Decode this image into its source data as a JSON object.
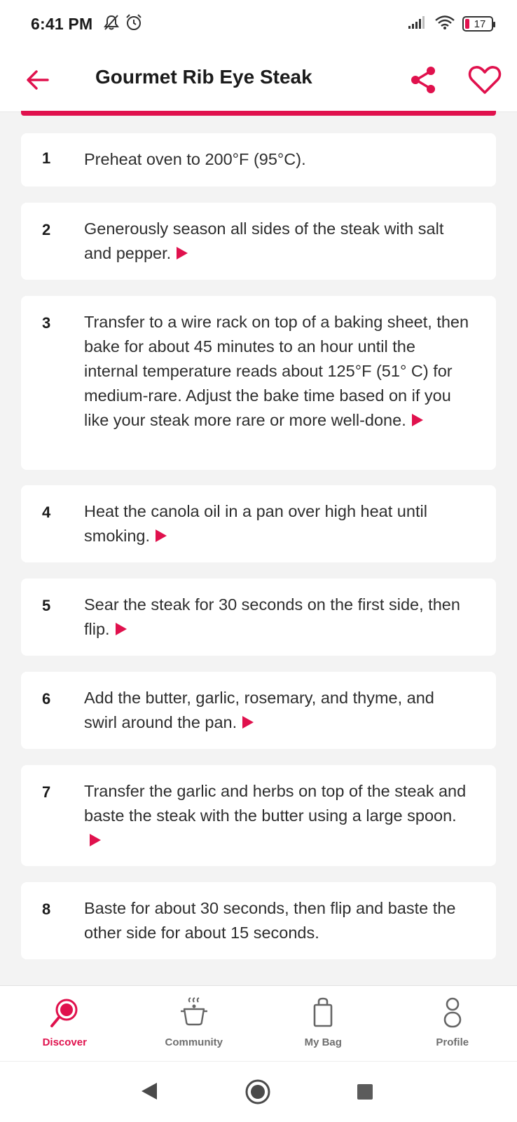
{
  "status_bar": {
    "time": "6:41 PM",
    "battery": "17",
    "icons": [
      "bell-off-icon",
      "alarm-icon",
      "signal-icon",
      "wifi-icon",
      "battery-icon"
    ]
  },
  "header": {
    "title": "Gourmet Rib Eye Steak",
    "icons": [
      "back-arrow-icon",
      "share-icon",
      "heart-icon"
    ]
  },
  "colors": {
    "accent": "#e0114d",
    "background": "#f3f3f3",
    "card": "#ffffff"
  },
  "steps": [
    {
      "number": "1",
      "text": "Preheat oven to 200°F (95°C).",
      "has_video": false
    },
    {
      "number": "2",
      "text": "Generously season all sides of the steak with salt and pepper.",
      "has_video": true
    },
    {
      "number": "3",
      "text": "Transfer to a wire rack on top of a baking sheet, then bake for about 45 minutes to an hour until the internal temperature reads about 125°F (51° C) for medium-rare. Adjust the bake time based on if you like your steak more rare or more well-done.",
      "has_video": true
    },
    {
      "number": "4",
      "text": "Heat the canola oil in a pan over high heat until smoking.",
      "has_video": true
    },
    {
      "number": "5",
      "text": "Sear the steak for 30 seconds on the first side, then flip.",
      "has_video": true
    },
    {
      "number": "6",
      "text": "Add the butter, garlic, rosemary, and thyme, and swirl around the pan.",
      "has_video": true
    },
    {
      "number": "7",
      "text": "Transfer the garlic and herbs on top of the steak and baste the steak with the butter using a large spoon.",
      "has_video": true
    },
    {
      "number": "8",
      "text": "Baste for about 30 seconds, then flip and baste the other side for about 15 seconds.",
      "has_video": false
    }
  ],
  "bottom_nav": {
    "items": [
      {
        "label": "Discover",
        "icon": "discover-icon",
        "active": true
      },
      {
        "label": "Community",
        "icon": "community-pot-icon",
        "active": false
      },
      {
        "label": "My Bag",
        "icon": "bag-icon",
        "active": false
      },
      {
        "label": "Profile",
        "icon": "profile-icon",
        "active": false
      }
    ]
  },
  "system_nav": {
    "icons": [
      "system-back-icon",
      "system-home-icon",
      "system-recents-icon"
    ]
  }
}
